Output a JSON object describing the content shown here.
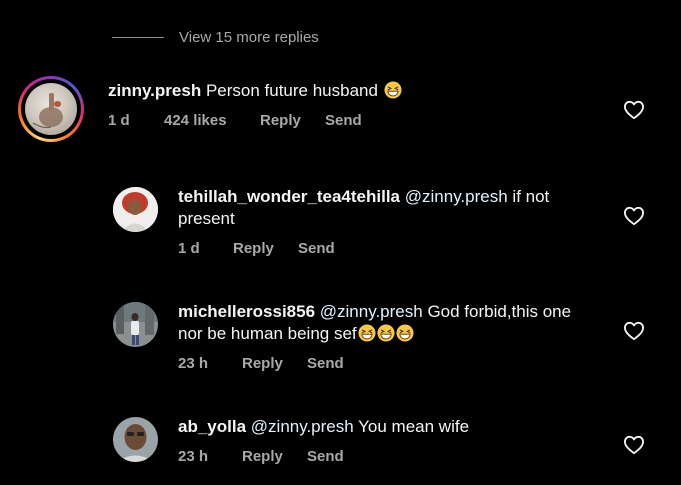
{
  "view_more": {
    "label": "View 15 more replies"
  },
  "comments": [
    {
      "username": "zinny.presh",
      "text": "Person future husband",
      "emoji_count": 1,
      "time": "1 d",
      "likes": "424 likes",
      "reply_label": "Reply",
      "send_label": "Send",
      "has_story_ring": true
    },
    {
      "username": "tehillah_wonder_tea4tehilla",
      "mention": "@zinny.presh",
      "text_line1": "if not",
      "text_line2": "present",
      "time": "1 d",
      "reply_label": "Reply",
      "send_label": "Send"
    },
    {
      "username": "michellerossi856",
      "mention": "@zinny.presh",
      "text_line1": "God forbid,this one",
      "text_line2": "nor be human being sef",
      "emoji_count": 3,
      "time": "23 h",
      "reply_label": "Reply",
      "send_label": "Send"
    },
    {
      "username": "ab_yolla",
      "mention": "@zinny.presh",
      "text": "You mean wife",
      "time": "23 h",
      "reply_label": "Reply",
      "send_label": "Send"
    }
  ],
  "colors": {
    "background": "#000000",
    "primary_text": "#f5f5f5",
    "secondary_text": "#a8a8a8",
    "mention": "#e0f1ff"
  },
  "icons": {
    "like": "heart-outline-icon",
    "emoji": "grinning-squinting-face-emoji"
  }
}
